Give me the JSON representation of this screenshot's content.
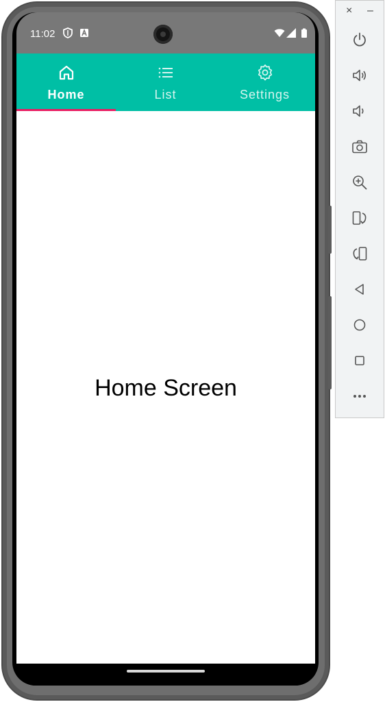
{
  "status_bar": {
    "time": "11:02",
    "icons": [
      "shield-icon",
      "a-badge-icon",
      "wifi-icon",
      "signal-icon",
      "battery-icon"
    ]
  },
  "tabs": [
    {
      "label": "Home",
      "icon": "home-icon",
      "active": true
    },
    {
      "label": "List",
      "icon": "list-icon",
      "active": false
    },
    {
      "label": "Settings",
      "icon": "gear-icon",
      "active": false
    }
  ],
  "content": {
    "title": "Home Screen"
  },
  "colors": {
    "tab_bar": "#00bfa5",
    "indicator": "#e91e63",
    "status_bar": "#787878",
    "content_bg": "#ffffff"
  },
  "emulator_toolbar": {
    "close_label": "×",
    "minimize_label": "–",
    "buttons": [
      "power-icon",
      "volume-up-icon",
      "volume-down-icon",
      "camera-icon",
      "zoom-icon",
      "rotate-left-icon",
      "rotate-right-icon",
      "back-icon",
      "home-circle-icon",
      "overview-icon",
      "more-icon"
    ]
  }
}
